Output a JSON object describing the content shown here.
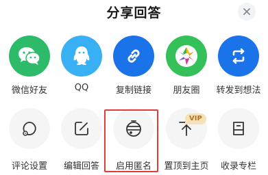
{
  "title": "分享回答",
  "icons": {
    "close": "close-icon"
  },
  "colors": {
    "wechat": "#2dbb6a",
    "qq": "#3ab0f4",
    "blue": "#1a73e8",
    "highlight": "#e23b3b",
    "vip_bg": "#f6e1b8",
    "vip_text": "#b5741c"
  },
  "share_row": [
    {
      "label": "微信好友",
      "icon": "wechat-icon"
    },
    {
      "label": "QQ",
      "icon": "qq-icon"
    },
    {
      "label": "复制链接",
      "icon": "link-icon"
    },
    {
      "label": "朋友圈",
      "icon": "moments-icon"
    },
    {
      "label": "转发到想法",
      "icon": "repost-icon"
    }
  ],
  "action_row": [
    {
      "label": "评论设置",
      "icon": "comment-settings-icon"
    },
    {
      "label": "编辑回答",
      "icon": "edit-icon"
    },
    {
      "label": "启用匿名",
      "icon": "anonymous-icon"
    },
    {
      "label": "置顶到主页",
      "icon": "pin-top-icon",
      "badge": "VIP"
    },
    {
      "label": "收录专栏",
      "icon": "column-icon"
    }
  ]
}
